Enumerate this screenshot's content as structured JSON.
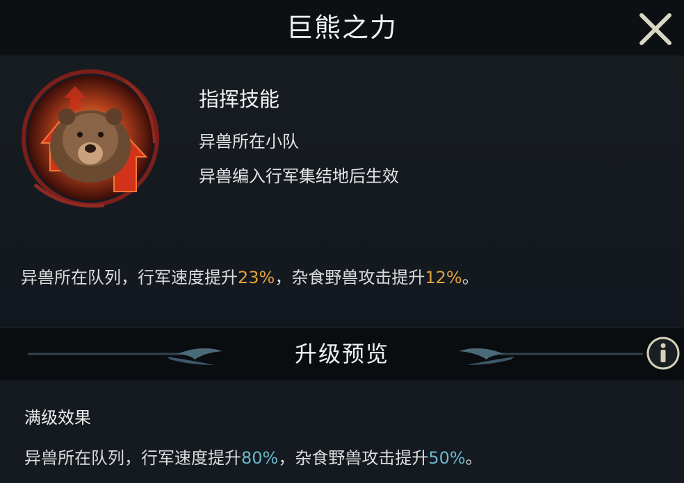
{
  "header": {
    "title": "巨熊之力",
    "close_icon": "close-icon"
  },
  "skill": {
    "icon": "bear-skill-icon",
    "type": "指挥技能",
    "line1": "异兽所在小队",
    "line2": "异兽编入行军集结地后生效"
  },
  "current_effect": {
    "part1": "异兽所在队列，行军速度提升",
    "value1": "23%",
    "part2": "，杂食野兽攻击提升",
    "value2": "12%",
    "part3": "。"
  },
  "upgrade": {
    "title": "升级预览",
    "info_icon": "info-icon"
  },
  "max_effect": {
    "label": "满级效果",
    "part1": "异兽所在队列，行军速度提升",
    "value1": "80%",
    "part2": "，杂食野兽攻击提升",
    "value2": "50%",
    "part3": "。"
  },
  "colors": {
    "current_value": "#e2a23a",
    "max_value": "#6ab8cc",
    "background": "#12171b"
  }
}
